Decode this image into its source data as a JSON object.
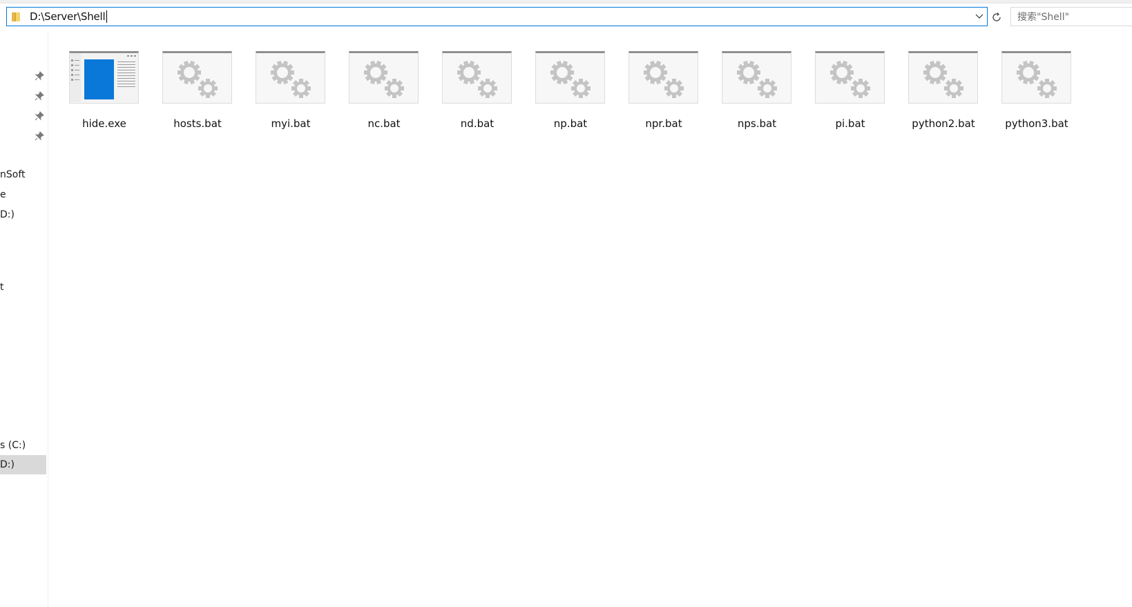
{
  "address_bar": {
    "path": "D:\\Server\\Shell"
  },
  "search": {
    "placeholder": "搜索\"Shell\""
  },
  "nav": {
    "items": [
      {
        "label": "nSoft"
      },
      {
        "label": "e"
      },
      {
        "label": "D:)"
      },
      {
        "label": "t"
      },
      {
        "label": "s (C:)"
      },
      {
        "label": "D:)",
        "selected": true
      }
    ]
  },
  "files": [
    {
      "name": "hide.exe",
      "icon": "application-window-icon"
    },
    {
      "name": "hosts.bat",
      "icon": "batch-gears-icon"
    },
    {
      "name": "myi.bat",
      "icon": "batch-gears-icon"
    },
    {
      "name": "nc.bat",
      "icon": "batch-gears-icon"
    },
    {
      "name": "nd.bat",
      "icon": "batch-gears-icon"
    },
    {
      "name": "np.bat",
      "icon": "batch-gears-icon"
    },
    {
      "name": "npr.bat",
      "icon": "batch-gears-icon"
    },
    {
      "name": "nps.bat",
      "icon": "batch-gears-icon"
    },
    {
      "name": "pi.bat",
      "icon": "batch-gears-icon"
    },
    {
      "name": "python2.bat",
      "icon": "batch-gears-icon"
    },
    {
      "name": "python3.bat",
      "icon": "batch-gears-icon"
    }
  ],
  "colors": {
    "accent": "#0078d7",
    "selected_bg": "#d9d9d9",
    "gear": "#c4c4c4"
  }
}
